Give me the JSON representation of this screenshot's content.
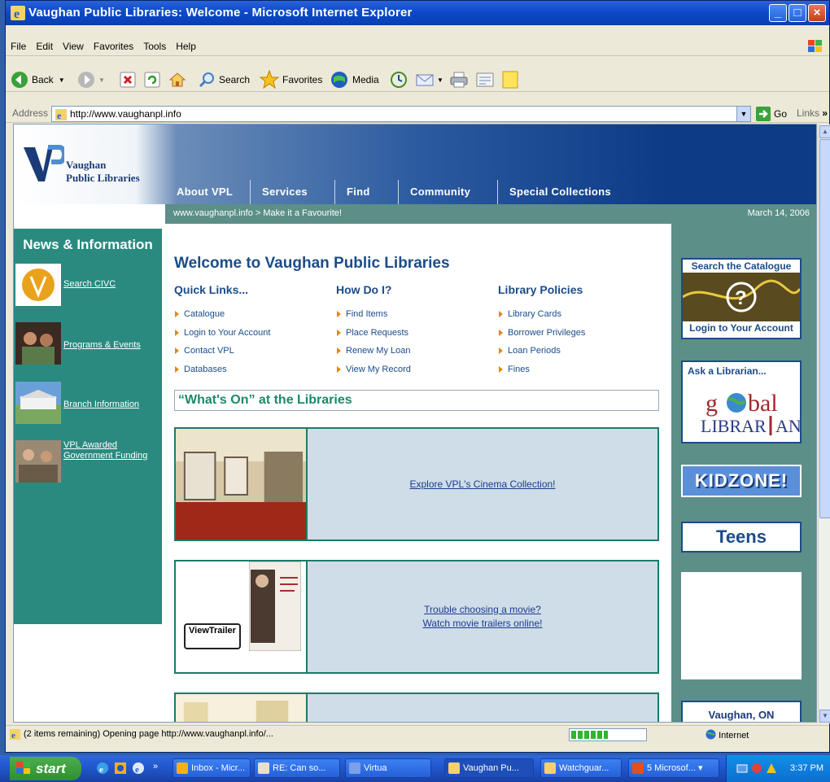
{
  "window": {
    "title": "Vaughan Public Libraries: Welcome - Microsoft Internet Explorer"
  },
  "menu": [
    "File",
    "Edit",
    "View",
    "Favorites",
    "Tools",
    "Help"
  ],
  "toolbar": {
    "back": "Back",
    "search": "Search",
    "favorites": "Favorites",
    "media": "Media"
  },
  "address": {
    "label": "Address",
    "url": "http://www.vaughanpl.info",
    "go": "Go",
    "links": "Links"
  },
  "page": {
    "logo": {
      "line1": "Vaughan",
      "line2": "Public Libraries"
    },
    "nav": [
      "About VPL",
      "Services",
      "Find",
      "Community",
      "Special Collections"
    ],
    "subbar": {
      "left": "www.vaughanpl.info > Make it a Favourite!",
      "date": "March 14, 2006"
    },
    "news": {
      "heading": "News & Information",
      "items": [
        "Search CIVC",
        "Programs & Events",
        "Branch Information",
        "VPL Awarded Government Funding"
      ]
    },
    "welcome": "Welcome to Vaughan Public Libraries",
    "columns": [
      {
        "heading": "Quick Links...",
        "items": [
          "Catalogue",
          "Login to Your Account",
          "Contact VPL",
          "Databases"
        ]
      },
      {
        "heading": "How Do I?",
        "items": [
          "Find Items",
          "Place Requests",
          "Renew My Loan",
          "View My Record"
        ]
      },
      {
        "heading": "Library Policies",
        "items": [
          "Library Cards",
          "Borrower Privileges",
          "Loan Periods",
          "Fines"
        ]
      }
    ],
    "whatson": "“What's On” at the Libraries",
    "promos": [
      {
        "line1": "Explore VPL's Cinema Collection!",
        "line2": ""
      },
      {
        "line1": "Trouble choosing a movie?",
        "line2": "Watch movie trailers online!",
        "badge": "ViewTrailer"
      }
    ],
    "right": {
      "search_catalogue": "Search the Catalogue",
      "login": "Login to Your Account",
      "ask": "Ask a Librarian...",
      "global_librarian": "global LIBRARIAN",
      "kidzone": "KIDZONE!",
      "teens": "Teens",
      "location": "Vaughan, ON"
    }
  },
  "status": {
    "text": "(2 items remaining) Opening page http://www.vaughanpl.info/...",
    "zone": "Internet",
    "progress": 0.5
  },
  "taskbar": {
    "start": "start",
    "tasks": [
      "Inbox - Micr...",
      "RE: Can so...",
      "Virtua",
      "Vaughan Pu...",
      "Watchguar...",
      "5 Microsof..."
    ],
    "clock": "3:37 PM"
  },
  "colors": {
    "teal": "#2a8a80",
    "navy": "#1b4c8a",
    "xp_blue": "#0a48c8"
  }
}
